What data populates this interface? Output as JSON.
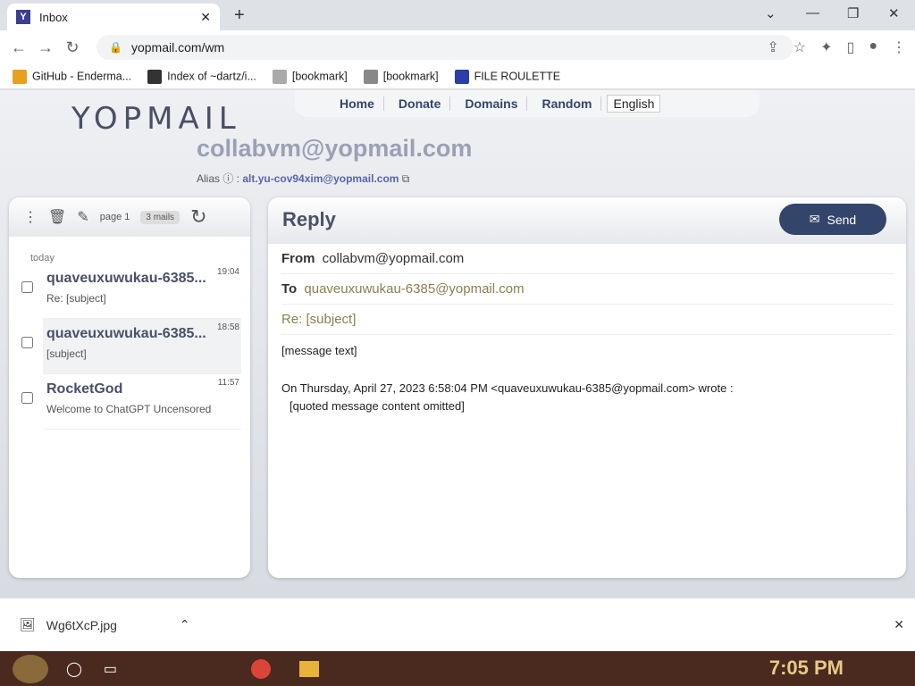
{
  "browser": {
    "tab_title": "Inbox",
    "url": "yopmail.com/wm",
    "bookmarks": [
      "GitHub - Enderma...",
      "Index of ~dartz/i...",
      "[bookmark]",
      "[bookmark]",
      "FILE ROULETTE"
    ]
  },
  "site": {
    "logo": "YOPMAIL",
    "menu": [
      "Home",
      "Donate",
      "Domains",
      "Random"
    ],
    "language": "English",
    "mailbox": "collabvm@yopmail.com",
    "alias_label": "Alias",
    "alias_value": "alt.yu-cov94xim@yopmail.com"
  },
  "inbox": {
    "page": "page 1",
    "count": "3 mails",
    "day": "today",
    "items": [
      {
        "from": "quaveuxuwukau-6385...",
        "subject": "Re: [subject]",
        "time": "19:04"
      },
      {
        "from": "quaveuxuwukau-6385...",
        "subject": "[subject]",
        "time": "18:58"
      },
      {
        "from": "RocketGod",
        "subject": "Welcome to ChatGPT Uncensored",
        "time": "11:57"
      }
    ]
  },
  "reply": {
    "title": "Reply",
    "send": "Send",
    "from_label": "From",
    "from": "collabvm@yopmail.com",
    "to_label": "To",
    "to": "quaveuxuwukau-6385@yopmail.com",
    "subject": "Re: [subject]",
    "body_line": "[message text]",
    "quote_header": "On Thursday, April 27, 2023 6:58:04 PM <quaveuxuwukau-6385@yopmail.com> wrote :",
    "quote_body": "[quoted message content omitted]"
  },
  "download": {
    "file": "Wg6tXcP.jpg"
  },
  "taskbar": {
    "time": "7:05 PM"
  }
}
